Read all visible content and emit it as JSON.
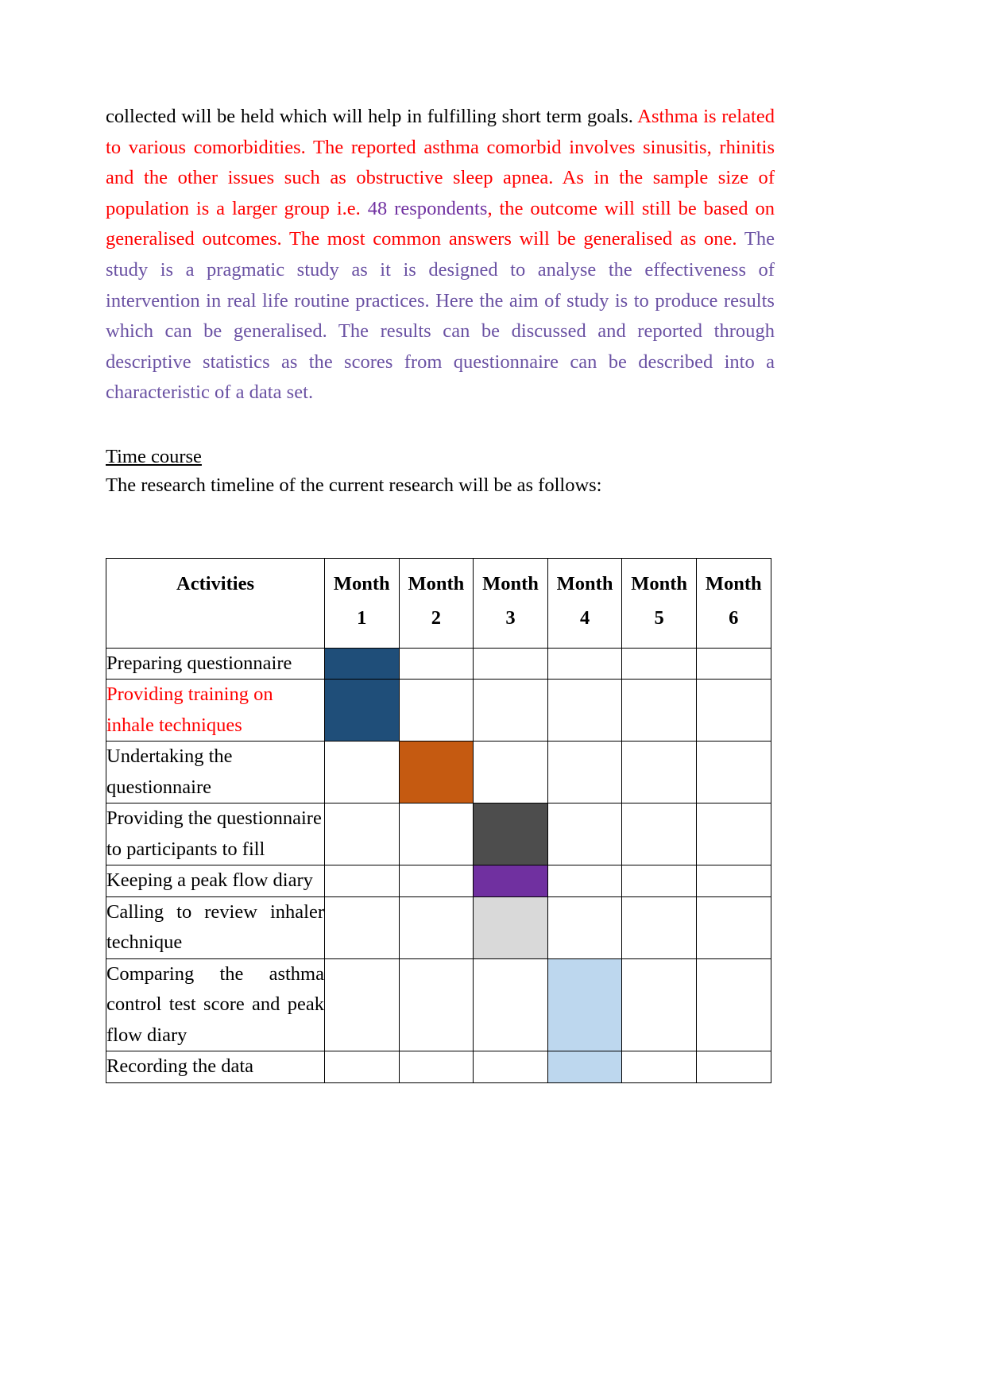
{
  "document": {
    "paragraph1": {
      "segment_black": "collected will be held which will help in fulfilling short term goals. ",
      "segment_red_a": "Asthma is related to various comorbidities. The reported asthma comorbid involves sinusitis, rhinitis and the other issues such as obstructive sleep apnea. As in the sample size of population is a larger group i.e. ",
      "segment_purple_inline": "48 respondents",
      "segment_red_b": ", the outcome will still be based on generalised outcomes. The most common answers will be generalised as one. ",
      "segment_violet": "The study is a pragmatic study as it is designed to analyse the effectiveness of intervention in real life routine practices. Here the aim of study is to produce results which can be generalised. The results can be discussed and reported through descriptive statistics as the scores from questionnaire can be described into a characteristic of a data set."
    },
    "heading_time_course": "Time course",
    "intro_line": "The research timeline of the current research will be as follows:"
  },
  "colors": {
    "text_black": "#000000",
    "text_red": "#ff0000",
    "text_purple": "#7030a0",
    "text_violet": "#6a51a3",
    "bar_dark_blue": "#1f4e79",
    "bar_orange": "#c55a11",
    "bar_dark_gray": "#4d4d4d",
    "bar_purple": "#7030a0",
    "bar_light_gray": "#d9d9d9",
    "bar_light_blue": "#bdd7ee",
    "border": "#000000"
  },
  "chart_data": {
    "type": "table",
    "title": "Research Timeline (Gantt)",
    "columns": [
      "Activities",
      "Month 1",
      "Month 2",
      "Month 3",
      "Month 4",
      "Month 5",
      "Month 6"
    ],
    "header": {
      "activities": "Activities",
      "month_word": "Month",
      "month_numbers": [
        "1",
        "2",
        "3",
        "4",
        "5",
        "6"
      ]
    },
    "rows": [
      {
        "activity": "Preparing questionnaire",
        "activity_color": "#000000",
        "align": "left",
        "bars": [
          {
            "month": 1,
            "color": "#1f4e79"
          }
        ]
      },
      {
        "activity": "Providing training on inhale techniques",
        "activity_color": "#ff0000",
        "align": "left",
        "bars": [
          {
            "month": 1,
            "color": "#1f4e79"
          }
        ]
      },
      {
        "activity": "Undertaking the questionnaire",
        "activity_color": "#000000",
        "align": "left",
        "bars": [
          {
            "month": 2,
            "color": "#c55a11"
          }
        ]
      },
      {
        "activity": "Providing the questionnaire to participants to fill",
        "activity_color": "#000000",
        "align": "left",
        "bars": [
          {
            "month": 3,
            "color": "#4d4d4d"
          }
        ]
      },
      {
        "activity": "Keeping a peak flow diary",
        "activity_color": "#000000",
        "align": "left",
        "bars": [
          {
            "month": 3,
            "color": "#7030a0"
          }
        ]
      },
      {
        "activity": "Calling to review inhaler technique",
        "activity_color": "#000000",
        "align": "justify",
        "bars": [
          {
            "month": 3,
            "color": "#d9d9d9"
          }
        ]
      },
      {
        "activity": "Comparing the asthma control test score and peak flow diary",
        "activity_color": "#000000",
        "align": "justify",
        "bars": [
          {
            "month": 4,
            "color": "#bdd7ee"
          }
        ]
      },
      {
        "activity": "Recording the data",
        "activity_color": "#000000",
        "align": "left",
        "bars": [
          {
            "month": 4,
            "color": "#bdd7ee"
          }
        ]
      }
    ]
  }
}
